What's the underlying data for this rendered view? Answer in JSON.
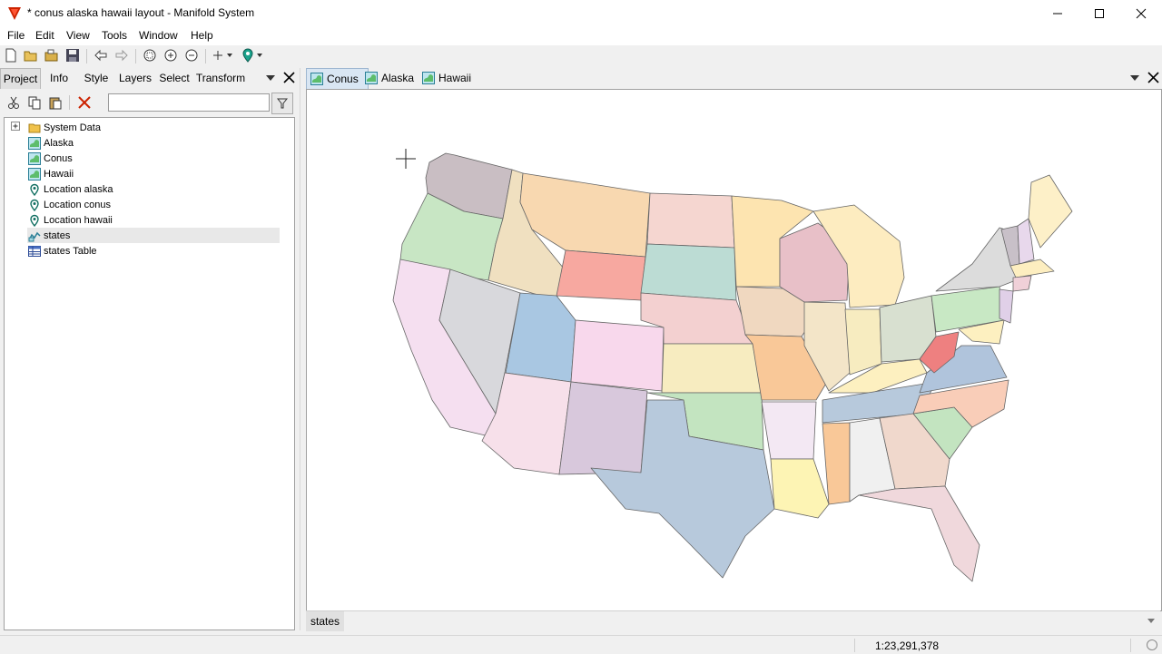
{
  "window": {
    "title": "* conus alaska hawaii layout - Manifold System",
    "minimize_icon": "minimize-icon",
    "maximize_icon": "maximize-icon",
    "close_icon": "close-icon"
  },
  "menu": [
    "File",
    "Edit",
    "View",
    "Tools",
    "Window",
    "Help"
  ],
  "toolbar_icons": [
    "new-icon",
    "open-icon",
    "open-folder-icon",
    "save-icon",
    "back-icon",
    "forward-icon",
    "zoom-window-icon",
    "zoom-in-icon",
    "zoom-out-icon",
    "add-icon",
    "location-icon"
  ],
  "left_panel": {
    "tabs": [
      "Project",
      "Info",
      "Style",
      "Layers",
      "Select",
      "Transform"
    ],
    "active_tab": "Project",
    "filter_placeholder": "",
    "tree": [
      {
        "label": "System Data",
        "icon": "folder-icon",
        "expandable": true
      },
      {
        "label": "Alaska",
        "icon": "map-icon"
      },
      {
        "label": "Conus",
        "icon": "map-icon"
      },
      {
        "label": "Hawaii",
        "icon": "map-icon"
      },
      {
        "label": "Location alaska",
        "icon": "location-icon"
      },
      {
        "label": "Location conus",
        "icon": "location-icon"
      },
      {
        "label": "Location hawaii",
        "icon": "location-icon"
      },
      {
        "label": "states",
        "icon": "drawing-icon",
        "selected": true
      },
      {
        "label": "states Table",
        "icon": "table-icon"
      }
    ]
  },
  "map_tabs": [
    {
      "label": "Conus",
      "active": true
    },
    {
      "label": "Alaska",
      "active": false
    },
    {
      "label": "Hawaii",
      "active": false
    }
  ],
  "layer_tab": "states",
  "status": {
    "scale": "1:23,291,378"
  },
  "colors": {
    "map_bg": "#ffffff",
    "active_tab_bg": "#d9e6f3",
    "accent_red": "#cc2200"
  }
}
